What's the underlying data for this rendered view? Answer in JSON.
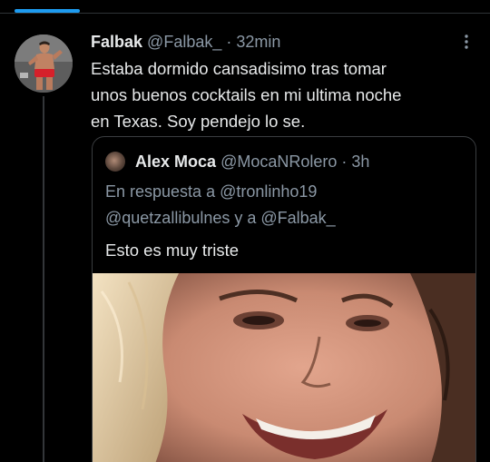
{
  "tweet": {
    "author_name": "Falbak",
    "author_handle": "@Falbak_",
    "separator": "·",
    "timestamp": "32min",
    "text_lines": [
      "Estaba dormido cansadisimo tras tomar",
      "unos buenos cocktails en mi ultima noche",
      "en Texas. Soy pendejo lo se."
    ]
  },
  "quote": {
    "author_name": "Alex Moca",
    "author_handle": "@MocaNRolero",
    "separator": "·",
    "timestamp": "3h",
    "reply_context_lines": [
      "En respuesta a @tronlinho19",
      "@quetzallibulnes y a @Falbak_"
    ],
    "text": "Esto es muy triste"
  },
  "colors": {
    "background": "#000000",
    "text_primary": "#e7e9ea",
    "text_secondary": "#8b98a5",
    "accent": "#1d9bf0",
    "border": "#3a3d40"
  },
  "icons": {
    "more": "more-vertical-icon"
  }
}
